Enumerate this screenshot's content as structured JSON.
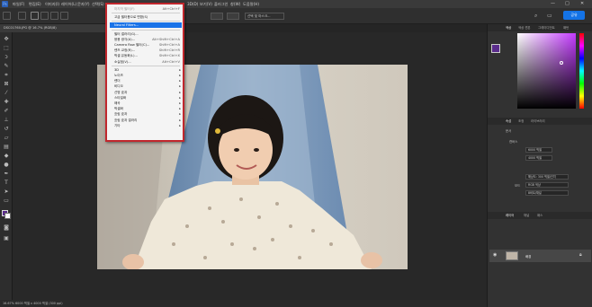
{
  "menubar": {
    "items": [
      "파일(F)",
      "편집(E)",
      "이미지(I)",
      "레이어(L)",
      "문자(Y)",
      "선택(S)",
      "필터(T)",
      "3D(D)",
      "보기(V)",
      "플러그인",
      "창(W)",
      "도움말(H)"
    ],
    "window_controls": [
      "—",
      "□",
      "✕"
    ]
  },
  "optionsbar": {
    "select_subject_label": "선택 및 마스크...",
    "share_label": "공유"
  },
  "document_tab": {
    "label": "DSC01760.JPG @ 16.7% (RGB/8)"
  },
  "status_bar": {
    "text": "16.67%   6000 픽셀 x 4000 픽셀 (300 ppi)"
  },
  "filter_menu": {
    "items": [
      {
        "label": "마지막 필터(F)",
        "shortcut": "Alt+Ctrl+F",
        "disabled": true
      },
      {
        "separator": true
      },
      {
        "label": "고급 필터용으로 변환(S)"
      },
      {
        "separator": true
      },
      {
        "label": "Neural Filters...",
        "highlighted": true
      },
      {
        "separator": true
      },
      {
        "label": "필터 갤러리(G)..."
      },
      {
        "label": "응용 광각(A)...",
        "shortcut": "Alt+Shift+Ctrl+A"
      },
      {
        "label": "Camera Raw 필터(C)...",
        "shortcut": "Shift+Ctrl+A"
      },
      {
        "label": "렌즈 교정(R)...",
        "shortcut": "Shift+Ctrl+R"
      },
      {
        "label": "픽셀 유동화(L)...",
        "shortcut": "Shift+Ctrl+X"
      },
      {
        "label": "소실점(V)...",
        "shortcut": "Alt+Ctrl+V"
      },
      {
        "separator": true
      },
      {
        "label": "3D",
        "submenu": true
      },
      {
        "label": "노이즈",
        "submenu": true
      },
      {
        "label": "렌더",
        "submenu": true
      },
      {
        "label": "비디오",
        "submenu": true
      },
      {
        "label": "선명 효과",
        "submenu": true
      },
      {
        "label": "스타일화",
        "submenu": true
      },
      {
        "label": "왜곡",
        "submenu": true
      },
      {
        "label": "픽셀화",
        "submenu": true
      },
      {
        "label": "흐림 효과",
        "submenu": true
      },
      {
        "label": "흐림 효과 갤러리",
        "submenu": true
      },
      {
        "label": "기타",
        "submenu": true
      }
    ]
  },
  "panels": {
    "color_tabs": [
      "색상",
      "색상 견본",
      "그레이디언트",
      "패턴"
    ],
    "props_tabs": [
      "속성",
      "조정",
      "라이브러리"
    ],
    "props_section": "캔버스",
    "props_doc_label": "문서",
    "width_value": "6000 픽셀",
    "height_value": "4000 픽셀",
    "resolution_value": "해상도: 300 픽셀/인치",
    "mode_label": "모드",
    "mode_value": "RGB 색상",
    "depth_value": "8비트/채널",
    "layers_tabs": [
      "레이어",
      "채널",
      "패스"
    ],
    "layer_name": "배경"
  },
  "colors": {
    "foreground": "#5a2c8c",
    "accent": "#1473e6",
    "menu_highlight": "#1a73e8",
    "menu_border": "#c1272d"
  }
}
